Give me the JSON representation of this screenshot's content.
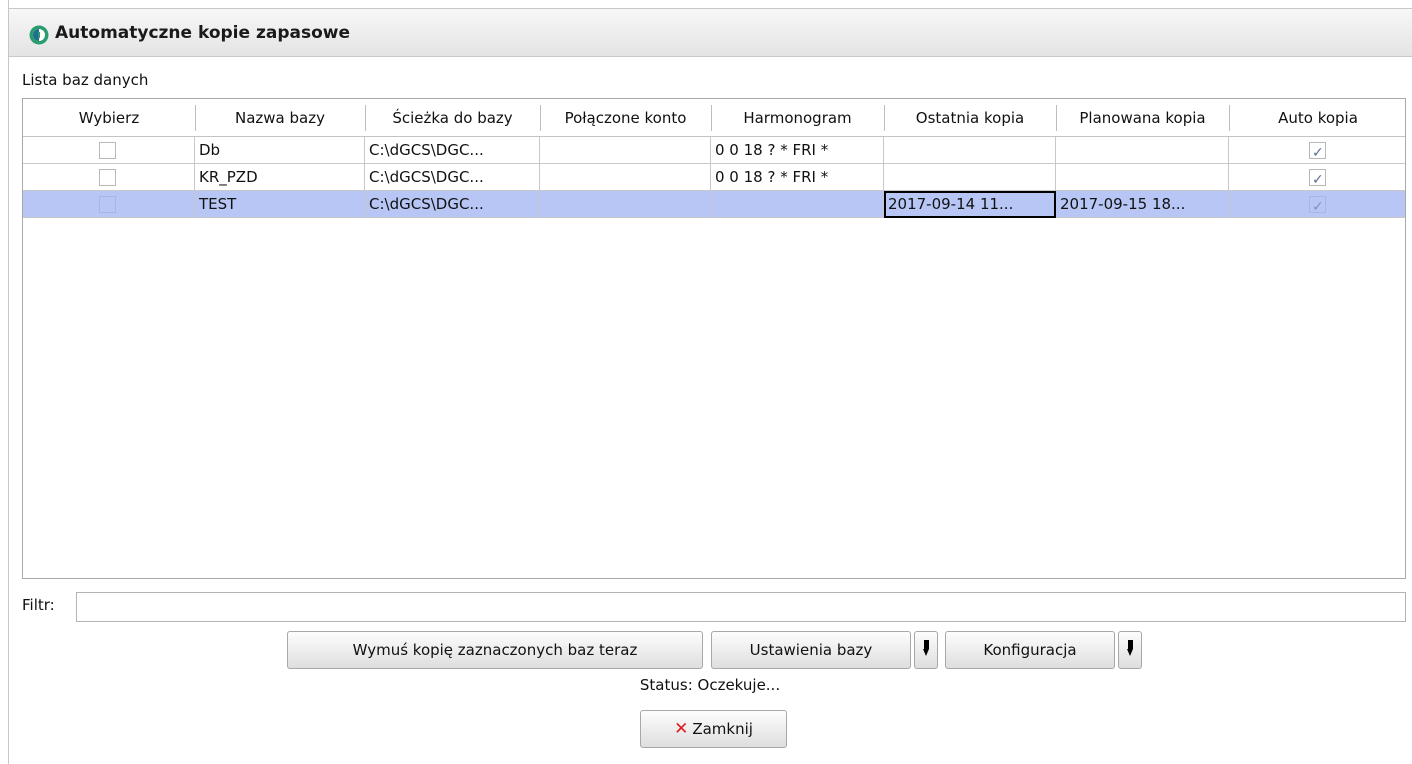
{
  "window": {
    "title": "Automatyczne kopie zapasowe"
  },
  "list_caption": "Lista baz danych",
  "columns": [
    "Wybierz",
    "Nazwa bazy",
    "Ścieżka do bazy",
    "Połączone konto",
    "Harmonogram",
    "Ostatnia kopia",
    "Planowana kopia",
    "Auto kopia"
  ],
  "rows": [
    {
      "selected_checkbox": false,
      "name": "Db",
      "path": "C:\\dGCS\\DGC...",
      "account": "",
      "schedule": "0 0 18 ? * FRI *",
      "last_backup": "",
      "planned_backup": "",
      "auto_backup": true
    },
    {
      "selected_checkbox": false,
      "name": "KR_PZD",
      "path": "C:\\dGCS\\DGC...",
      "account": "",
      "schedule": "0 0 18 ? * FRI *",
      "last_backup": "",
      "planned_backup": "",
      "auto_backup": true
    },
    {
      "selected_checkbox": false,
      "name": "TEST",
      "path": "C:\\dGCS\\DGC...",
      "account": "",
      "schedule": "",
      "last_backup": "2017-09-14 11...",
      "planned_backup": "2017-09-15 18...",
      "auto_backup": true
    }
  ],
  "selected_row": 2,
  "filter": {
    "label": "Filtr:",
    "value": ""
  },
  "buttons": {
    "force_backup": "Wymuś kopię zaznaczonych baz teraz",
    "db_settings": "Ustawienia bazy",
    "configuration": "Konfiguracja",
    "close": "Zamknij"
  },
  "status": "Status: Oczekuje...",
  "colors": {
    "selection": "#b7c6f5",
    "close_icon": "#e01b1b",
    "app_icon": "#2a9d6f"
  },
  "icons": {
    "app": "app-logo-icon",
    "close": "close-x-icon",
    "dropdown": "dropdown-arrow-icon",
    "check": "checkmark-icon"
  }
}
